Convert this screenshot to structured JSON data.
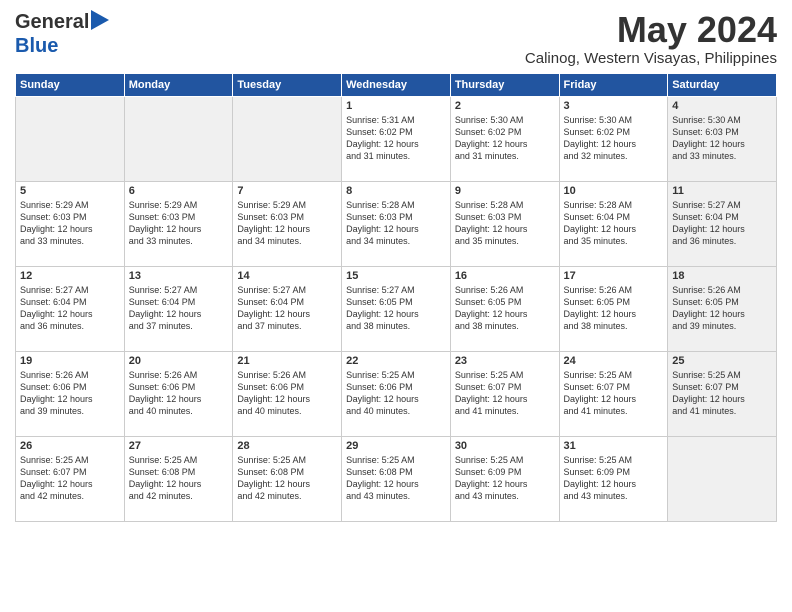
{
  "header": {
    "logo_general": "General",
    "logo_blue": "Blue",
    "month_title": "May 2024",
    "location": "Calinog, Western Visayas, Philippines"
  },
  "weekdays": [
    "Sunday",
    "Monday",
    "Tuesday",
    "Wednesday",
    "Thursday",
    "Friday",
    "Saturday"
  ],
  "weeks": [
    {
      "cells": [
        {
          "day": "",
          "shaded": true,
          "lines": []
        },
        {
          "day": "",
          "shaded": true,
          "lines": []
        },
        {
          "day": "",
          "shaded": true,
          "lines": []
        },
        {
          "day": "1",
          "shaded": false,
          "lines": [
            "Sunrise: 5:31 AM",
            "Sunset: 6:02 PM",
            "Daylight: 12 hours",
            "and 31 minutes."
          ]
        },
        {
          "day": "2",
          "shaded": false,
          "lines": [
            "Sunrise: 5:30 AM",
            "Sunset: 6:02 PM",
            "Daylight: 12 hours",
            "and 31 minutes."
          ]
        },
        {
          "day": "3",
          "shaded": false,
          "lines": [
            "Sunrise: 5:30 AM",
            "Sunset: 6:02 PM",
            "Daylight: 12 hours",
            "and 32 minutes."
          ]
        },
        {
          "day": "4",
          "shaded": true,
          "lines": [
            "Sunrise: 5:30 AM",
            "Sunset: 6:03 PM",
            "Daylight: 12 hours",
            "and 33 minutes."
          ]
        }
      ]
    },
    {
      "cells": [
        {
          "day": "5",
          "shaded": false,
          "lines": [
            "Sunrise: 5:29 AM",
            "Sunset: 6:03 PM",
            "Daylight: 12 hours",
            "and 33 minutes."
          ]
        },
        {
          "day": "6",
          "shaded": false,
          "lines": [
            "Sunrise: 5:29 AM",
            "Sunset: 6:03 PM",
            "Daylight: 12 hours",
            "and 33 minutes."
          ]
        },
        {
          "day": "7",
          "shaded": false,
          "lines": [
            "Sunrise: 5:29 AM",
            "Sunset: 6:03 PM",
            "Daylight: 12 hours",
            "and 34 minutes."
          ]
        },
        {
          "day": "8",
          "shaded": false,
          "lines": [
            "Sunrise: 5:28 AM",
            "Sunset: 6:03 PM",
            "Daylight: 12 hours",
            "and 34 minutes."
          ]
        },
        {
          "day": "9",
          "shaded": false,
          "lines": [
            "Sunrise: 5:28 AM",
            "Sunset: 6:03 PM",
            "Daylight: 12 hours",
            "and 35 minutes."
          ]
        },
        {
          "day": "10",
          "shaded": false,
          "lines": [
            "Sunrise: 5:28 AM",
            "Sunset: 6:04 PM",
            "Daylight: 12 hours",
            "and 35 minutes."
          ]
        },
        {
          "day": "11",
          "shaded": true,
          "lines": [
            "Sunrise: 5:27 AM",
            "Sunset: 6:04 PM",
            "Daylight: 12 hours",
            "and 36 minutes."
          ]
        }
      ]
    },
    {
      "cells": [
        {
          "day": "12",
          "shaded": false,
          "lines": [
            "Sunrise: 5:27 AM",
            "Sunset: 6:04 PM",
            "Daylight: 12 hours",
            "and 36 minutes."
          ]
        },
        {
          "day": "13",
          "shaded": false,
          "lines": [
            "Sunrise: 5:27 AM",
            "Sunset: 6:04 PM",
            "Daylight: 12 hours",
            "and 37 minutes."
          ]
        },
        {
          "day": "14",
          "shaded": false,
          "lines": [
            "Sunrise: 5:27 AM",
            "Sunset: 6:04 PM",
            "Daylight: 12 hours",
            "and 37 minutes."
          ]
        },
        {
          "day": "15",
          "shaded": false,
          "lines": [
            "Sunrise: 5:27 AM",
            "Sunset: 6:05 PM",
            "Daylight: 12 hours",
            "and 38 minutes."
          ]
        },
        {
          "day": "16",
          "shaded": false,
          "lines": [
            "Sunrise: 5:26 AM",
            "Sunset: 6:05 PM",
            "Daylight: 12 hours",
            "and 38 minutes."
          ]
        },
        {
          "day": "17",
          "shaded": false,
          "lines": [
            "Sunrise: 5:26 AM",
            "Sunset: 6:05 PM",
            "Daylight: 12 hours",
            "and 38 minutes."
          ]
        },
        {
          "day": "18",
          "shaded": true,
          "lines": [
            "Sunrise: 5:26 AM",
            "Sunset: 6:05 PM",
            "Daylight: 12 hours",
            "and 39 minutes."
          ]
        }
      ]
    },
    {
      "cells": [
        {
          "day": "19",
          "shaded": false,
          "lines": [
            "Sunrise: 5:26 AM",
            "Sunset: 6:06 PM",
            "Daylight: 12 hours",
            "and 39 minutes."
          ]
        },
        {
          "day": "20",
          "shaded": false,
          "lines": [
            "Sunrise: 5:26 AM",
            "Sunset: 6:06 PM",
            "Daylight: 12 hours",
            "and 40 minutes."
          ]
        },
        {
          "day": "21",
          "shaded": false,
          "lines": [
            "Sunrise: 5:26 AM",
            "Sunset: 6:06 PM",
            "Daylight: 12 hours",
            "and 40 minutes."
          ]
        },
        {
          "day": "22",
          "shaded": false,
          "lines": [
            "Sunrise: 5:25 AM",
            "Sunset: 6:06 PM",
            "Daylight: 12 hours",
            "and 40 minutes."
          ]
        },
        {
          "day": "23",
          "shaded": false,
          "lines": [
            "Sunrise: 5:25 AM",
            "Sunset: 6:07 PM",
            "Daylight: 12 hours",
            "and 41 minutes."
          ]
        },
        {
          "day": "24",
          "shaded": false,
          "lines": [
            "Sunrise: 5:25 AM",
            "Sunset: 6:07 PM",
            "Daylight: 12 hours",
            "and 41 minutes."
          ]
        },
        {
          "day": "25",
          "shaded": true,
          "lines": [
            "Sunrise: 5:25 AM",
            "Sunset: 6:07 PM",
            "Daylight: 12 hours",
            "and 41 minutes."
          ]
        }
      ]
    },
    {
      "cells": [
        {
          "day": "26",
          "shaded": false,
          "lines": [
            "Sunrise: 5:25 AM",
            "Sunset: 6:07 PM",
            "Daylight: 12 hours",
            "and 42 minutes."
          ]
        },
        {
          "day": "27",
          "shaded": false,
          "lines": [
            "Sunrise: 5:25 AM",
            "Sunset: 6:08 PM",
            "Daylight: 12 hours",
            "and 42 minutes."
          ]
        },
        {
          "day": "28",
          "shaded": false,
          "lines": [
            "Sunrise: 5:25 AM",
            "Sunset: 6:08 PM",
            "Daylight: 12 hours",
            "and 42 minutes."
          ]
        },
        {
          "day": "29",
          "shaded": false,
          "lines": [
            "Sunrise: 5:25 AM",
            "Sunset: 6:08 PM",
            "Daylight: 12 hours",
            "and 43 minutes."
          ]
        },
        {
          "day": "30",
          "shaded": false,
          "lines": [
            "Sunrise: 5:25 AM",
            "Sunset: 6:09 PM",
            "Daylight: 12 hours",
            "and 43 minutes."
          ]
        },
        {
          "day": "31",
          "shaded": false,
          "lines": [
            "Sunrise: 5:25 AM",
            "Sunset: 6:09 PM",
            "Daylight: 12 hours",
            "and 43 minutes."
          ]
        },
        {
          "day": "",
          "shaded": true,
          "lines": []
        }
      ]
    }
  ]
}
